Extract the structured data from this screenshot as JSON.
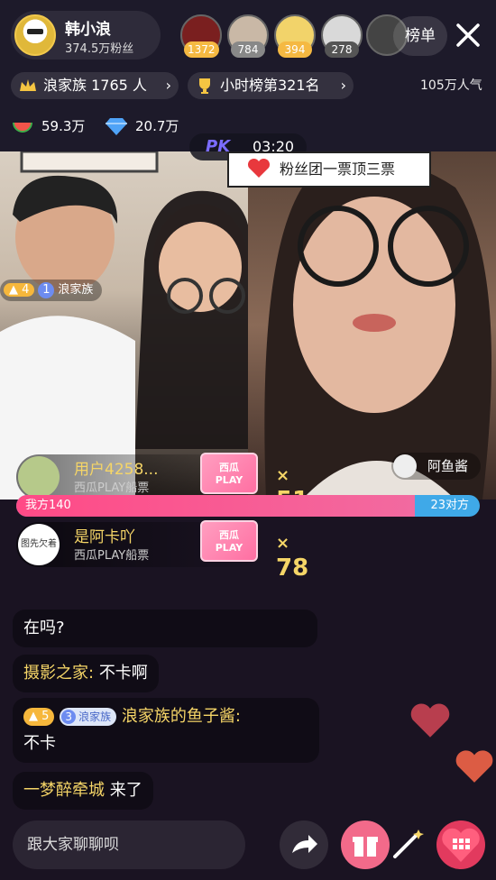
{
  "host": {
    "name": "韩小浪",
    "fans": "374.5万粉丝"
  },
  "viewers": [
    {
      "count": "1372",
      "color": "#f5b942",
      "bg": "#7a1f1f"
    },
    {
      "count": "784",
      "color": "#888888",
      "bg": "#c9b8a6"
    },
    {
      "count": "394",
      "color": "#f5b942",
      "bg": "#f2d36a"
    },
    {
      "count": "278",
      "color": "#555555",
      "bg": "#d9d9d9"
    }
  ],
  "rank_button": "榜单",
  "family": {
    "label": "浪家族 1765 人"
  },
  "hour_rank": {
    "label": "小时榜第321名"
  },
  "popularity": "105万人气",
  "stats": {
    "watermelon": "59.3万",
    "diamond": "20.7万"
  },
  "pk": {
    "logo": "PK",
    "timer": "03:20",
    "banner": "粉丝团一票顶三票"
  },
  "left_stream": {
    "level": "4",
    "badge_num": "1",
    "badge": "浪家族"
  },
  "opponent": {
    "name": "阿鱼酱"
  },
  "gifts": [
    {
      "user": "用户4258...",
      "item": "西瓜PLAY船票",
      "ticket": "西瓜\nPLAY",
      "ticket_a": "西瓜",
      "ticket_b": "PLAY",
      "x": "×",
      "count": "51"
    },
    {
      "user": "是阿卡吖",
      "item": "西瓜PLAY船票",
      "ticket_a": "西瓜",
      "ticket_b": "PLAY",
      "x": "×",
      "count": "78",
      "avatar_text": "图先欠着"
    }
  ],
  "pk_bar": {
    "ours": "我方140",
    "theirs": "23对方",
    "ours_fraction": 0.86
  },
  "chat": [
    {
      "text": "在吗?"
    },
    {
      "who": "摄影之家:",
      "text": "不卡啊"
    },
    {
      "level": "5",
      "badge_num": "3",
      "badge": "浪家族",
      "who": "浪家族的鱼子酱:",
      "text": "不卡"
    },
    {
      "who": "一梦醉牵城",
      "text": "来了"
    }
  ],
  "input": {
    "placeholder": "跟大家聊聊呗"
  },
  "colors": {
    "accent_pink": "#ff4a86",
    "opponent_blue": "#3fa9e8",
    "gold": "#f5d567"
  }
}
